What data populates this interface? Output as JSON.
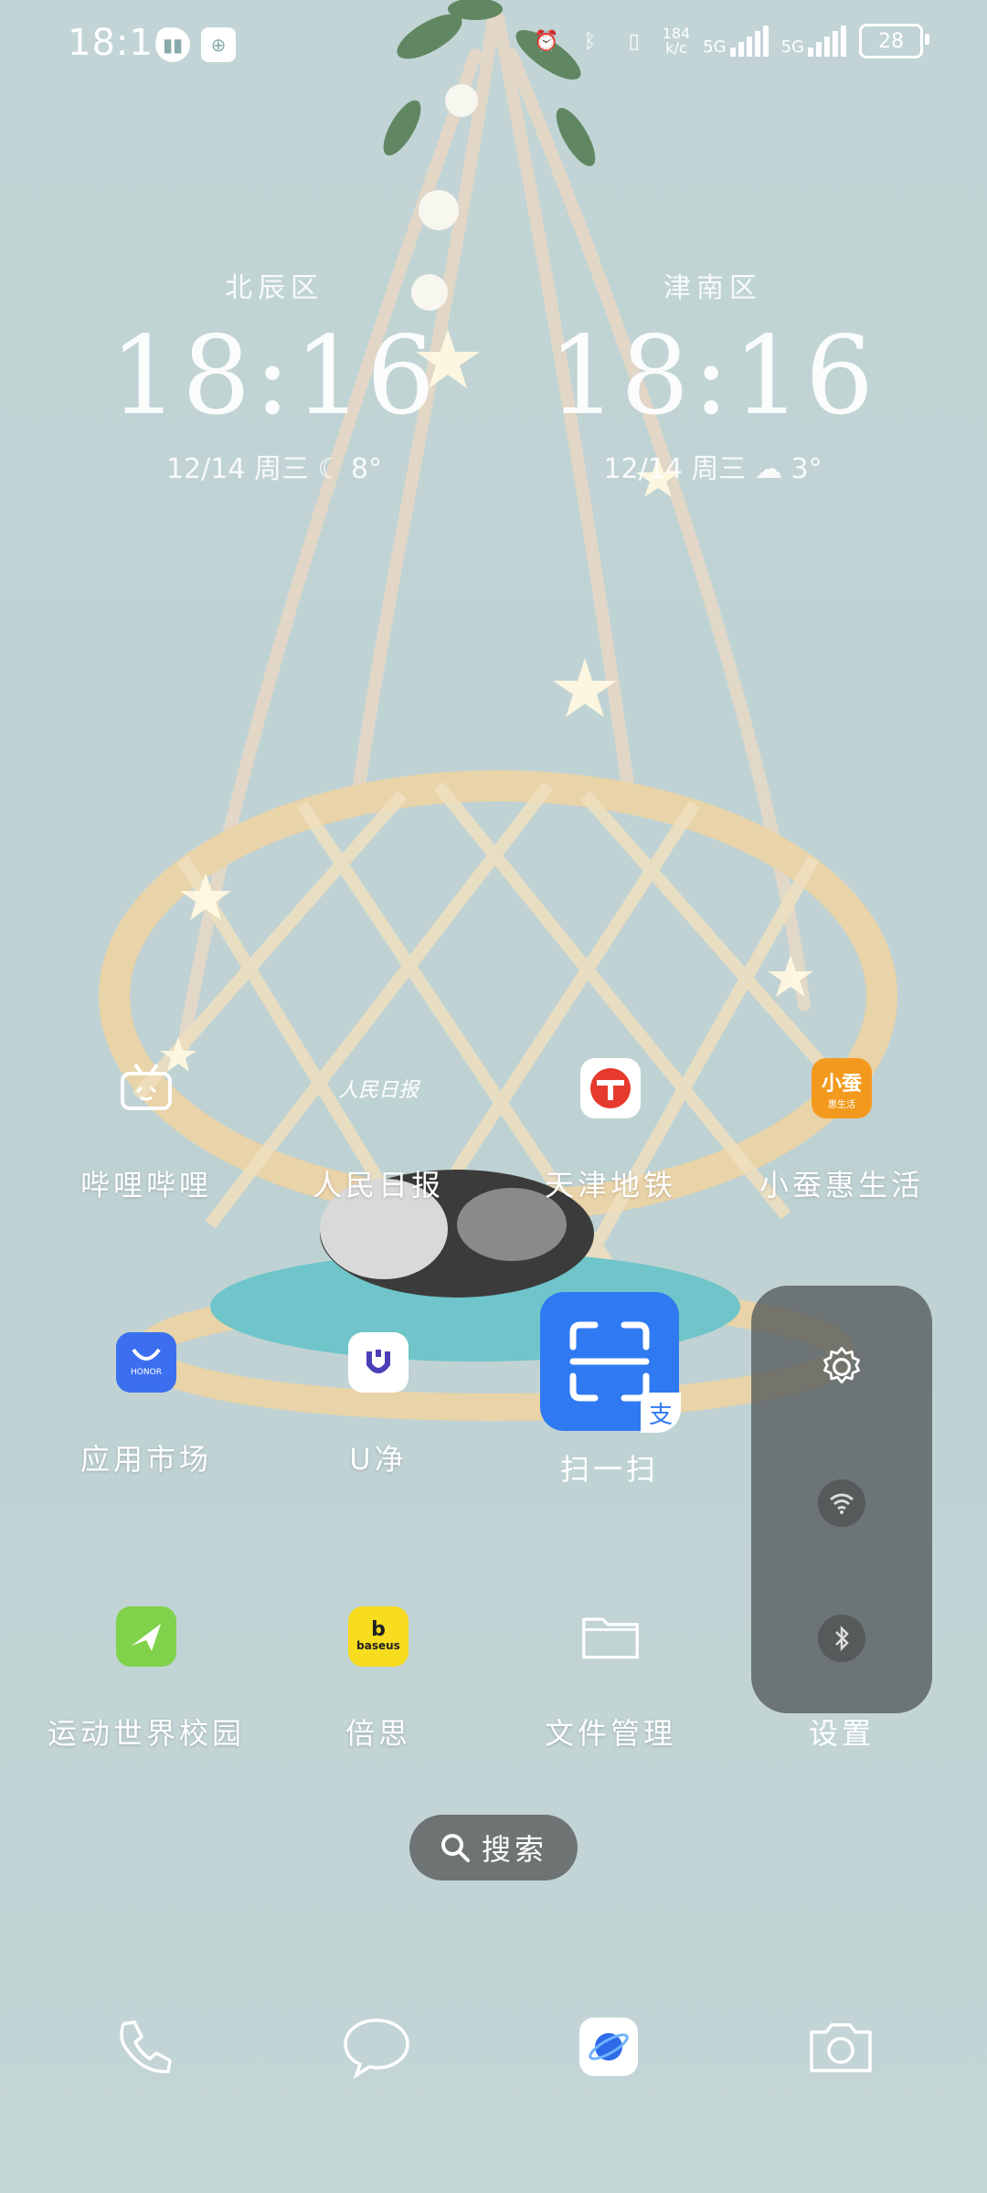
{
  "status_bar": {
    "time": "18:16",
    "net_speed_value": "184",
    "net_speed_unit": "k/c",
    "signal1": "5G",
    "signal2": "5G",
    "battery": "28"
  },
  "clocks": [
    {
      "city": "北辰区",
      "time": "18:16",
      "date": "12/14 周三",
      "temp": "8°"
    },
    {
      "city": "津南区",
      "time": "18:16",
      "date": "12/14 周三",
      "temp": "3°"
    }
  ],
  "apps": {
    "bilibili": "哔哩哔哩",
    "peoples_daily": "人民日报",
    "tianjin_metro": "天津地铁",
    "xiaocan": "小蚕惠生活",
    "app_market": "应用市场",
    "ujing": "U净",
    "scan": "扫一扫",
    "sport_campus": "运动世界校园",
    "baseus": "倍思",
    "file_manager": "文件管理",
    "settings": "设置"
  },
  "icon_texts": {
    "peoples_daily_logo": "人民日报",
    "xiaocan_top": "小蚕",
    "xiaocan_bottom": "惠生活",
    "app_market_logo": "HONOR",
    "baseus_logo": "baseus",
    "scan_badge": "支"
  },
  "search": {
    "label": "搜索"
  },
  "colors": {
    "wallpaper": "#c2d4d5",
    "scan_blue": "#2f7af2",
    "metro_red": "#e63a2e",
    "xiaocan_orange": "#f39a1e",
    "market_blue": "#3b6ff0",
    "sport_green": "#7fd24a",
    "baseus_yellow": "#f7dc1f"
  }
}
